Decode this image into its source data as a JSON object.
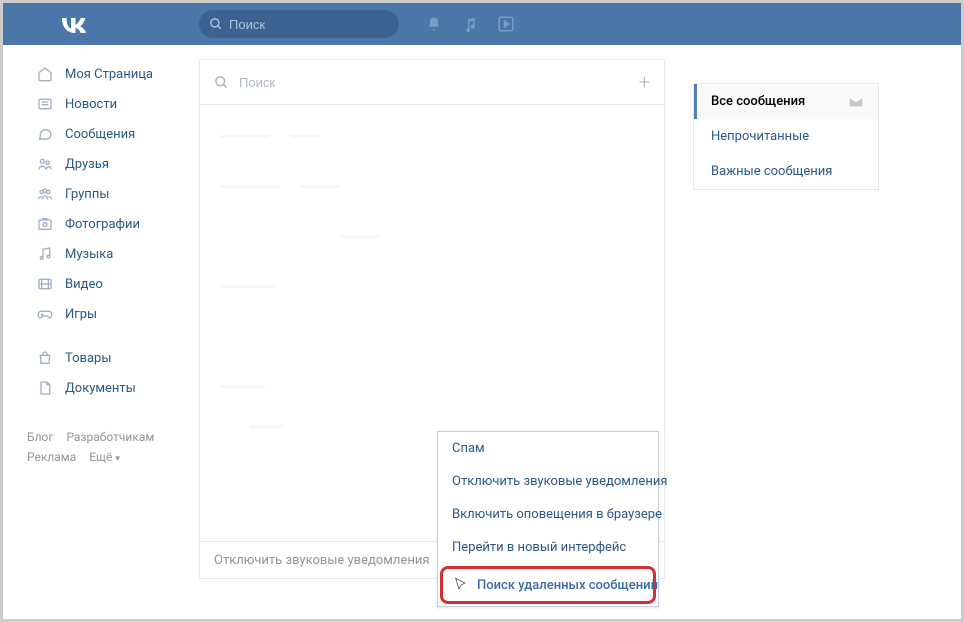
{
  "header": {
    "search_placeholder": "Поиск"
  },
  "sidebar": {
    "items": [
      {
        "label": "Моя Страница",
        "icon": "home"
      },
      {
        "label": "Новости",
        "icon": "news"
      },
      {
        "label": "Сообщения",
        "icon": "messages"
      },
      {
        "label": "Друзья",
        "icon": "friends"
      },
      {
        "label": "Группы",
        "icon": "groups"
      },
      {
        "label": "Фотографии",
        "icon": "photos"
      },
      {
        "label": "Музыка",
        "icon": "music"
      },
      {
        "label": "Видео",
        "icon": "video"
      },
      {
        "label": "Игры",
        "icon": "games"
      }
    ],
    "items2": [
      {
        "label": "Товары",
        "icon": "market"
      },
      {
        "label": "Документы",
        "icon": "docs"
      }
    ]
  },
  "footer": {
    "blog": "Блог",
    "developers": "Разработчикам",
    "ads": "Реклама",
    "more": "Ещё"
  },
  "messages": {
    "search_placeholder": "Поиск",
    "footer_text": "Отключить звуковые уведомления"
  },
  "right_tabs": [
    {
      "label": "Все сообщения",
      "active": true,
      "env": true
    },
    {
      "label": "Непрочитанные",
      "active": false
    },
    {
      "label": "Важные сообщения",
      "active": false
    }
  ],
  "popup": {
    "items": [
      "Спам",
      "Отключить звуковые уведомления",
      "Включить оповещения в браузере",
      "Перейти в новый интерфейс"
    ],
    "highlighted": "Поиск удаленных сообщений"
  }
}
